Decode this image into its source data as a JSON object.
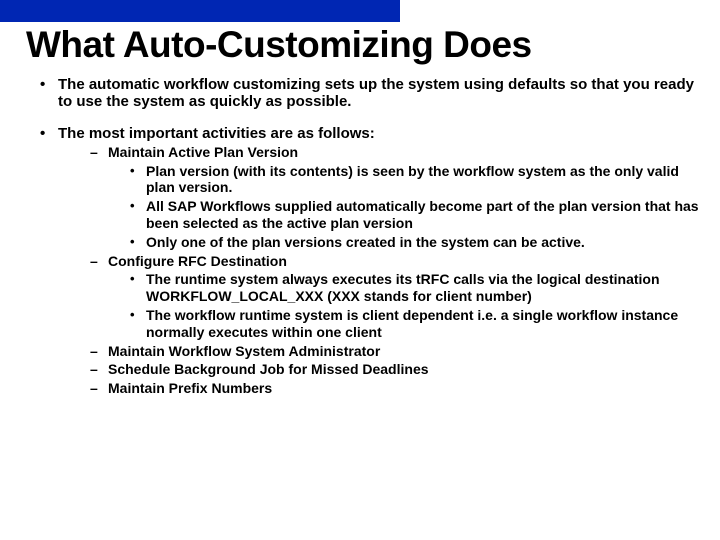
{
  "title": "What Auto-Customizing Does",
  "bullets": {
    "b1": "The automatic workflow customizing sets up the system using defaults so that you ready to use the system as quickly as possible.",
    "b2": "The most important activities are as follows:",
    "b2_1": "Maintain Active Plan Version",
    "b2_1_1": "Plan version (with its contents) is seen by the workflow system as the only valid plan version.",
    "b2_1_2": "All SAP Workflows supplied automatically become part of the plan version that has been selected as the active plan version",
    "b2_1_3": "Only one of the plan versions created in the system can be active.",
    "b2_2": "Configure RFC Destination",
    "b2_2_1": "The runtime system always executes its tRFC calls via the logical destination WORKFLOW_LOCAL_XXX (XXX stands for client number)",
    "b2_2_2": "The workflow runtime system is client dependent i.e. a single workflow instance normally executes within one client",
    "b2_3": "Maintain Workflow System Administrator",
    "b2_4": "Schedule Background Job for Missed Deadlines",
    "b2_5": "Maintain Prefix Numbers"
  }
}
